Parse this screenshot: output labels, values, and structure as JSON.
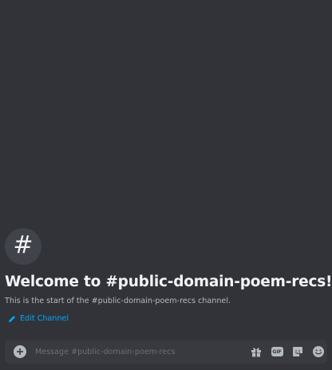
{
  "channel": {
    "name": "public-domain-poem-recs"
  },
  "welcome": {
    "hash_symbol": "#",
    "title": "Welcome to #public-domain-poem-recs!",
    "subtitle": "This is the start of the #public-domain-poem-recs channel.",
    "edit_label": "Edit Channel",
    "edit_icon": "pencil-icon"
  },
  "composer": {
    "placeholder": "Message #public-domain-poem-recs",
    "value": "",
    "add_icon": "plus-circle-icon",
    "gift_icon": "gift-icon",
    "gif_label": "GIF",
    "sticker_icon": "sticker-icon",
    "emoji_icon": "emoji-icon"
  },
  "colors": {
    "background": "#313338",
    "composer_bg": "#383a40",
    "link": "#00a8fc",
    "title": "#f2f3f5",
    "muted": "#b5bac1"
  }
}
